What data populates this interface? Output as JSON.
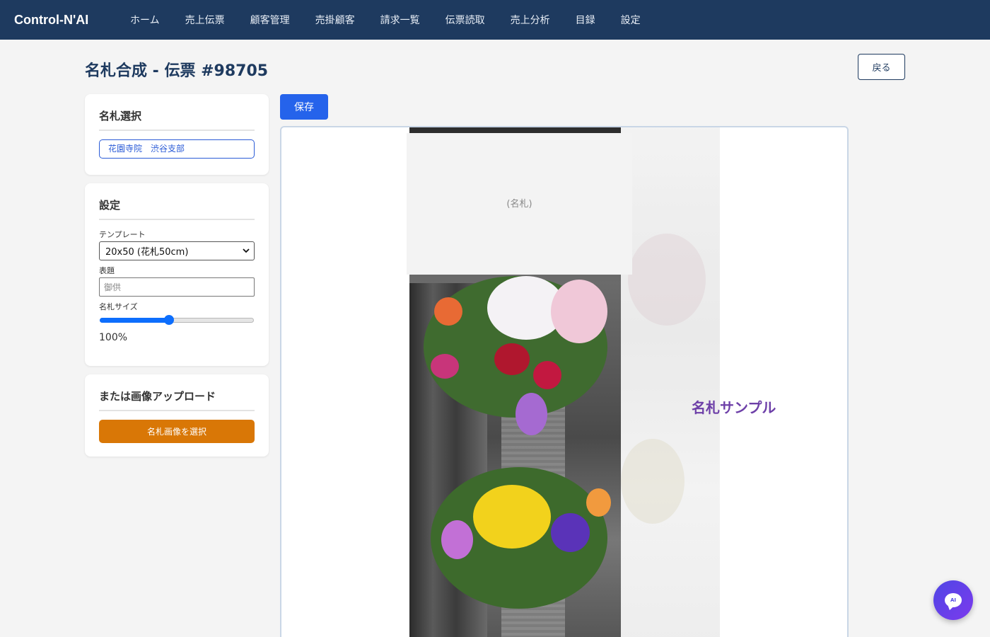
{
  "brand": "Control-N'AI",
  "nav": [
    "ホーム",
    "売上伝票",
    "顧客管理",
    "売掛顧客",
    "請求一覧",
    "伝票読取",
    "売上分析",
    "目録",
    "設定"
  ],
  "page_title": "名札合成 - 伝票 #98705",
  "back_label": "戻る",
  "save_label": "保存",
  "nameplate_select": {
    "title": "名札選択",
    "selected": "花園寺院　渋谷支部"
  },
  "settings": {
    "title": "設定",
    "template_label": "テンプレート",
    "template_value": "20x50 (花札50cm)",
    "heading_label": "表題",
    "heading_placeholder": "御供",
    "size_label": "名札サイズ",
    "size_value": "100%",
    "size_level": 0.45
  },
  "upload": {
    "title": "または画像アップロード",
    "button_label": "名札画像を選択"
  },
  "canvas": {
    "nameplate_placeholder": "(名札)",
    "sample_text": "名札サンプル"
  },
  "ai_button": "AI",
  "colors": {
    "nav_bg": "#1e3a5f",
    "primary": "#2563eb",
    "upload": "#d97706",
    "sample_text": "#6d3fa8"
  }
}
